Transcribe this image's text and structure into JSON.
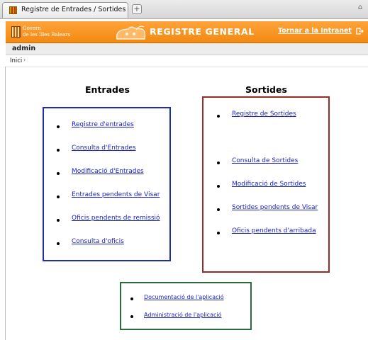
{
  "browser": {
    "tab_title": "Registre de Entrades / Sortides",
    "new_tab_label": "+"
  },
  "banner": {
    "logo_line1": "Govern",
    "logo_line2": "de les Illes Balears",
    "title": "REGISTRE GENERAL",
    "back_link": "Tornar a la Intranet",
    "accent_color": "#f28a12"
  },
  "user_bar": {
    "username": "admin"
  },
  "breadcrumb": {
    "home": "Inici",
    "separator": "›"
  },
  "entrades": {
    "heading": "Entrades",
    "box_color": "#1e2eb0",
    "links": [
      "Registre d'entrades",
      "Consulta d'Entrades",
      "Modificació d'Entrades",
      "Entrades pendents de Visar",
      "Oficis pendents de remissió",
      "Consulta d'oficis"
    ]
  },
  "sortides": {
    "heading": "Sortides",
    "box_color": "#9c2a2a",
    "links": [
      "Registre de Sortides",
      "Consulta de Sortides",
      "Modificació de Sortides",
      "Sortides pendents de Visar",
      "Oficis pendents d'arribada"
    ]
  },
  "extra": {
    "box_color": "#2e6b3e",
    "links": [
      "Documentació de l'aplicació",
      "Administració de l'aplicació"
    ]
  },
  "icons": {
    "tab_favicon": "govern-emblem-icon",
    "logo": "govern-emblem-icon",
    "banner_decoration": "folder-mascot-icon",
    "back_link_icon": "exit-arrow-icon",
    "bullet": "bullet-icon"
  }
}
